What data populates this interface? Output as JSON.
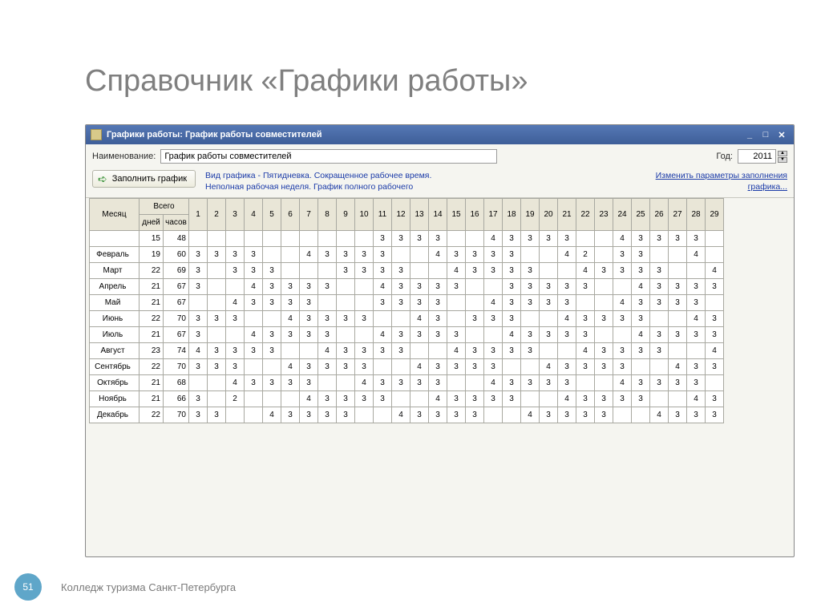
{
  "slide": {
    "title": "Справочник «Графики работы»",
    "page_number": "51",
    "footer_text": "Колледж туризма Санкт-Петербурга"
  },
  "window": {
    "title": "Графики работы: График работы совместителей",
    "name_label": "Наименование:",
    "name_value": "График работы совместителей",
    "year_label": "Год:",
    "year_value": "2011",
    "fill_button": "Заполнить график",
    "desc1": "Вид графика - Пятидневка. Сокращенное рабочее время.",
    "desc2": "Неполная рабочая неделя. График полного рабочего",
    "change_link1": "Изменить параметры заполнения",
    "change_link2": "графика...",
    "headers": {
      "month": "Месяц",
      "total": "Всего",
      "days": "дней",
      "hours": "часов"
    }
  },
  "day_cols": [
    "1",
    "2",
    "3",
    "4",
    "5",
    "6",
    "7",
    "8",
    "9",
    "10",
    "11",
    "12",
    "13",
    "14",
    "15",
    "16",
    "17",
    "18",
    "19",
    "20",
    "21",
    "22",
    "23",
    "24",
    "25",
    "26",
    "27",
    "28",
    "29"
  ],
  "rows": [
    {
      "month": "",
      "days": "15",
      "hours": "48",
      "sel": true,
      "cells": [
        "",
        "",
        "",
        "",
        "",
        "",
        "",
        "",
        "",
        "",
        "3",
        "3",
        "3",
        "3",
        "",
        "",
        "4",
        "3",
        "3",
        "3",
        "3",
        "",
        "",
        "4",
        "3",
        "3",
        "3",
        "3",
        ""
      ]
    },
    {
      "month": "Февраль",
      "days": "19",
      "hours": "60",
      "cells": [
        "3",
        "3",
        "3",
        "3",
        "",
        "",
        "4",
        "3",
        "3",
        "3",
        "3",
        "",
        "",
        "4",
        "3",
        "3",
        "3",
        "3",
        "",
        "",
        "4",
        "2",
        "",
        "3",
        "3",
        "",
        "",
        "4",
        ""
      ]
    },
    {
      "month": "Март",
      "days": "22",
      "hours": "69",
      "cells": [
        "3",
        "",
        "3",
        "3",
        "3",
        "",
        "",
        "",
        "3",
        "3",
        "3",
        "3",
        "",
        "",
        "4",
        "3",
        "3",
        "3",
        "3",
        "",
        "",
        "4",
        "3",
        "3",
        "3",
        "3",
        "",
        "",
        "4"
      ]
    },
    {
      "month": "Апрель",
      "days": "21",
      "hours": "67",
      "cells": [
        "3",
        "",
        "",
        "4",
        "3",
        "3",
        "3",
        "3",
        "",
        "",
        "4",
        "3",
        "3",
        "3",
        "3",
        "",
        "",
        "3",
        "3",
        "3",
        "3",
        "3",
        "",
        "",
        "4",
        "3",
        "3",
        "3",
        "3"
      ]
    },
    {
      "month": "Май",
      "days": "21",
      "hours": "67",
      "cells": [
        "",
        "",
        "4",
        "3",
        "3",
        "3",
        "3",
        "",
        "",
        "",
        "3",
        "3",
        "3",
        "3",
        "",
        "",
        "4",
        "3",
        "3",
        "3",
        "3",
        "",
        "",
        "4",
        "3",
        "3",
        "3",
        "3",
        ""
      ]
    },
    {
      "month": "Июнь",
      "days": "22",
      "hours": "70",
      "cells": [
        "3",
        "3",
        "3",
        "",
        "",
        "4",
        "3",
        "3",
        "3",
        "3",
        "",
        "",
        "4",
        "3",
        "",
        "3",
        "3",
        "3",
        "",
        "",
        "4",
        "3",
        "3",
        "3",
        "3",
        "",
        "",
        "4",
        "3"
      ]
    },
    {
      "month": "Июль",
      "days": "21",
      "hours": "67",
      "cells": [
        "3",
        "",
        "",
        "4",
        "3",
        "3",
        "3",
        "3",
        "",
        "",
        "4",
        "3",
        "3",
        "3",
        "3",
        "",
        "",
        "4",
        "3",
        "3",
        "3",
        "3",
        "",
        "",
        "4",
        "3",
        "3",
        "3",
        "3"
      ]
    },
    {
      "month": "Август",
      "days": "23",
      "hours": "74",
      "cells": [
        "4",
        "3",
        "3",
        "3",
        "3",
        "",
        "",
        "4",
        "3",
        "3",
        "3",
        "3",
        "",
        "",
        "4",
        "3",
        "3",
        "3",
        "3",
        "",
        "",
        "4",
        "3",
        "3",
        "3",
        "3",
        "",
        "",
        "4"
      ]
    },
    {
      "month": "Сентябрь",
      "days": "22",
      "hours": "70",
      "cells": [
        "3",
        "3",
        "3",
        "",
        "",
        "4",
        "3",
        "3",
        "3",
        "3",
        "",
        "",
        "4",
        "3",
        "3",
        "3",
        "3",
        "",
        "",
        "4",
        "3",
        "3",
        "3",
        "3",
        "",
        "",
        "4",
        "3",
        "3"
      ]
    },
    {
      "month": "Октябрь",
      "days": "21",
      "hours": "68",
      "cells": [
        "",
        "",
        "4",
        "3",
        "3",
        "3",
        "3",
        "",
        "",
        "4",
        "3",
        "3",
        "3",
        "3",
        "",
        "",
        "4",
        "3",
        "3",
        "3",
        "3",
        "",
        "",
        "4",
        "3",
        "3",
        "3",
        "3",
        ""
      ]
    },
    {
      "month": "Ноябрь",
      "days": "21",
      "hours": "66",
      "cells": [
        "3",
        "",
        "2",
        "",
        "",
        "",
        "4",
        "3",
        "3",
        "3",
        "3",
        "",
        "",
        "4",
        "3",
        "3",
        "3",
        "3",
        "",
        "",
        "4",
        "3",
        "3",
        "3",
        "3",
        "",
        "",
        "4",
        "3"
      ]
    },
    {
      "month": "Декабрь",
      "days": "22",
      "hours": "70",
      "cells": [
        "3",
        "3",
        "",
        "",
        "4",
        "3",
        "3",
        "3",
        "3",
        "",
        "",
        "4",
        "3",
        "3",
        "3",
        "3",
        "",
        "",
        "4",
        "3",
        "3",
        "3",
        "3",
        "",
        "",
        "4",
        "3",
        "3",
        "3"
      ]
    }
  ]
}
